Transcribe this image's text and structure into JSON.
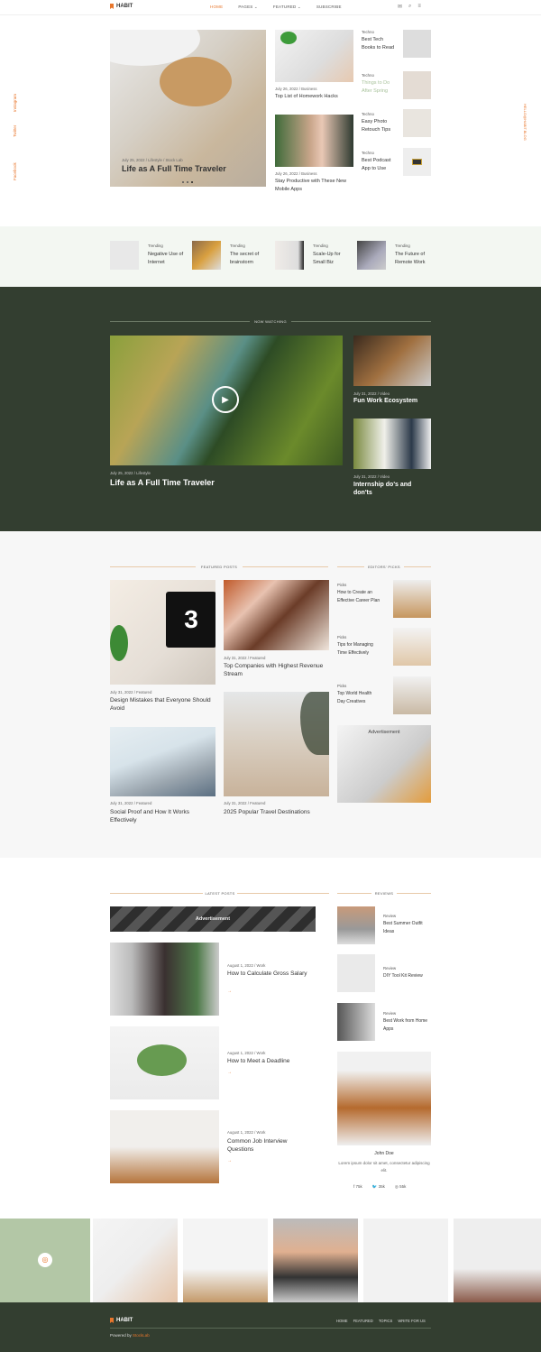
{
  "header": {
    "logo": "HABIT",
    "nav": [
      {
        "label": "HOME"
      },
      {
        "label": "PAGES ⌄"
      },
      {
        "label": "FEATURED ⌄"
      },
      {
        "label": "SUBSCRIBE"
      }
    ],
    "icons": [
      "mail-icon",
      "search-icon",
      "menu-icon"
    ]
  },
  "social_side": {
    "instagram": "Instagram",
    "twitter": "Twitter",
    "facebook": "Facebook"
  },
  "right_side": "HELLO@HABIT.BLOG",
  "hero": {
    "meta": "July 25, 2022  /  Lifestyle  /  Stock Lab",
    "title": "Life as A Full Time Traveler"
  },
  "hero_cards": [
    {
      "meta": "July 26, 2022  /  Business",
      "title": "Top List of Homework Hacks"
    },
    {
      "meta": "July 26, 2022  /  Business",
      "title": "Stay Productive with These New Mobile Apps"
    }
  ],
  "techno": [
    {
      "cat": "Techno",
      "title": "Best Tech Books to Read"
    },
    {
      "cat": "Techno",
      "title": "Things to Do After Spring"
    },
    {
      "cat": "Techno",
      "title": "Easy Photo Retouch Tips"
    },
    {
      "cat": "Techno",
      "title": "Best Podcast App to Use"
    }
  ],
  "trending": [
    {
      "cat": "Trending",
      "title": "Negative Use of Internet"
    },
    {
      "cat": "Trending",
      "title": "The secret of brainstorm"
    },
    {
      "cat": "Trending",
      "title": "Scale-Up for Small Biz"
    },
    {
      "cat": "Trending",
      "title": "The Future of Remote Work"
    }
  ],
  "watching": {
    "title": "NOW WATCHING",
    "main": {
      "meta": "July 25, 2022  /  Lifestyle",
      "title": "Life as A Full Time Traveler"
    },
    "side": [
      {
        "meta": "July 31, 2022  /  Video",
        "title": "Fun Work Ecosystem"
      },
      {
        "meta": "July 31, 2022  /  Video",
        "title": "Internship do's and don'ts"
      }
    ]
  },
  "featured": {
    "title": "FEATURED POSTS",
    "posts": [
      {
        "meta": "July 31, 2022  /  Featured",
        "title": "Design Mistakes that Everyone Should Avoid"
      },
      {
        "meta": "July 31, 2022  /  Featured",
        "title": "Top Companies with Highest Revenue Stream"
      },
      {
        "meta": "July 31, 2022  /  Featured",
        "title": "Social Proof and How It Works Effectively"
      },
      {
        "meta": "July 31, 2022  /  Featured",
        "title": "2025 Popular Travel Destinations"
      }
    ]
  },
  "editors": {
    "title": "EDITORS' PICKS",
    "items": [
      {
        "cat": "Picks",
        "title": "How to Create an Effective Career Plan"
      },
      {
        "cat": "Picks",
        "title": "Tips for Managing Time Effectively"
      },
      {
        "cat": "Picks",
        "title": "Top World Health Day Creatives"
      }
    ],
    "ad": "Advertisement"
  },
  "latest": {
    "title": "LATEST POSTS",
    "ad": "Advertisement",
    "posts": [
      {
        "meta": "August 1, 2022  /  Work",
        "title": "How to Calculate Gross Salary",
        "arrow": "→"
      },
      {
        "meta": "August 1, 2022  /  Work",
        "title": "How to Meet a Deadline",
        "arrow": "→"
      },
      {
        "meta": "August 1, 2022  /  Work",
        "title": "Common Job Interview Questions",
        "arrow": "→"
      }
    ]
  },
  "reviews": {
    "title": "REVIEWS",
    "items": [
      {
        "cat": "Review",
        "title": "Best Summer Outfit Ideas"
      },
      {
        "cat": "Review",
        "title": "DIY Tool Kit Review"
      },
      {
        "cat": "Review",
        "title": "Best Work from Home Apps"
      }
    ]
  },
  "author": {
    "name": "John Doe",
    "bio": "Lorem ipsum dolor sit amet, consectetur adipiscing elit.",
    "stats": [
      {
        "icon": "facebook-icon",
        "value": "75k"
      },
      {
        "icon": "twitter-icon",
        "value": "35k"
      },
      {
        "icon": "instagram-icon",
        "value": "55k"
      }
    ]
  },
  "footer": {
    "logo": "HABIT",
    "links": [
      "HOME",
      "FEATURED",
      "TOPICS",
      "WRITE FOR US"
    ],
    "powered": "Powered by ",
    "brand": "StockLab"
  },
  "colors": {
    "accent": "#e8762c",
    "dark": "#333e30",
    "sage": "#b3c7a6"
  }
}
